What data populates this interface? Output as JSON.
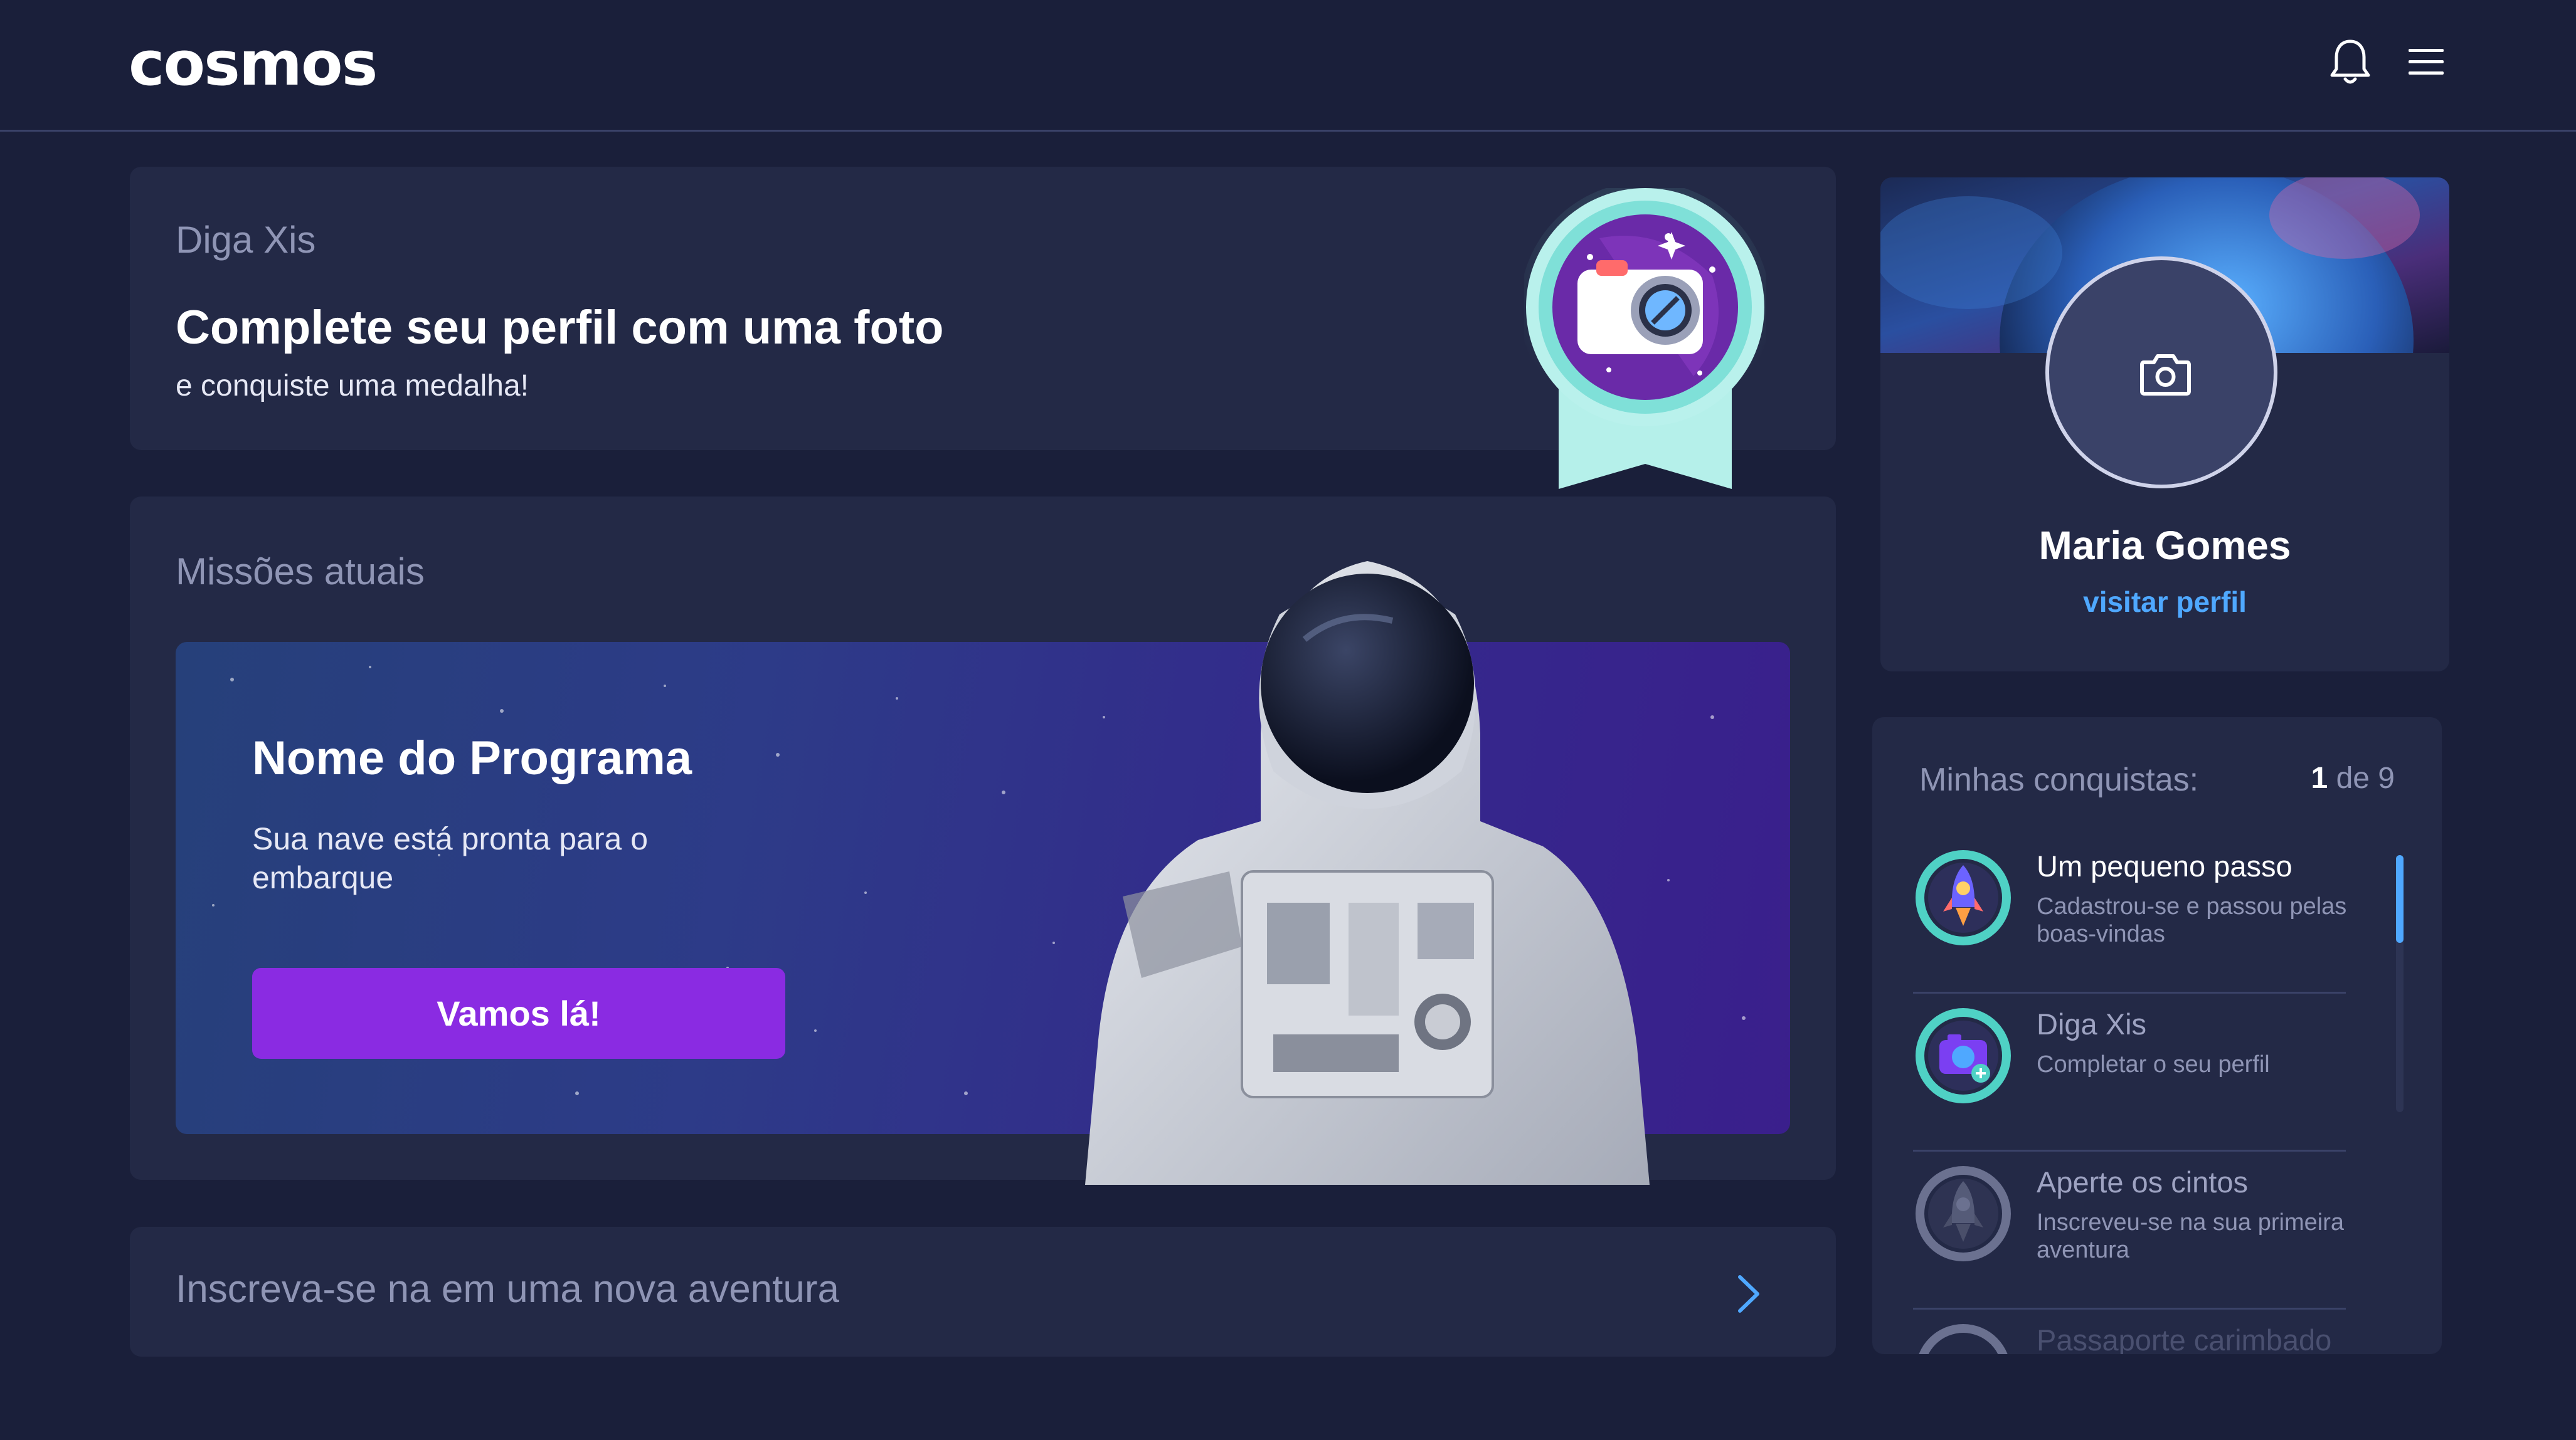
{
  "header": {
    "logo_text": "cosmos",
    "icons": [
      "bell-icon",
      "menu-icon"
    ]
  },
  "banner": {
    "eyebrow": "Diga Xis",
    "title": "Complete seu perfil com uma foto",
    "subtitle": "e conquiste uma medalha!"
  },
  "missions": {
    "title": "Missões atuais",
    "program_title": "Nome do Programa",
    "program_desc": "Sua nave está pronta para o embarque",
    "cta": "Vamos lá!"
  },
  "enroll": {
    "text": "Inscreva-se na em uma nova aventura"
  },
  "profile": {
    "name": "Maria Gomes",
    "link": "visitar perfil"
  },
  "achievements": {
    "title": "Minhas conquistas:",
    "count_done": "1",
    "count_rest": "de 9",
    "items": [
      {
        "name": "Um pequeno passo",
        "desc": "Cadastrou-se e passou pelas boas-vindas",
        "icon": "rocket-icon",
        "unlocked": true
      },
      {
        "name": "Diga Xis",
        "desc": "Completar o seu perfil",
        "icon": "camera-icon",
        "unlocked": false
      },
      {
        "name": "Aperte os cintos",
        "desc": "Inscreveu-se na sua primeira aventura",
        "icon": "rocket-locked-icon",
        "unlocked": false
      },
      {
        "name": "Passaporte carimbado",
        "desc": "",
        "icon": "passport-icon",
        "unlocked": false
      }
    ]
  },
  "colors": {
    "background": "#1a1f3a",
    "card": "#232946",
    "accent": "#8a2be2",
    "link": "#4fa8ff",
    "badge_ring": "#7fe0d8"
  }
}
